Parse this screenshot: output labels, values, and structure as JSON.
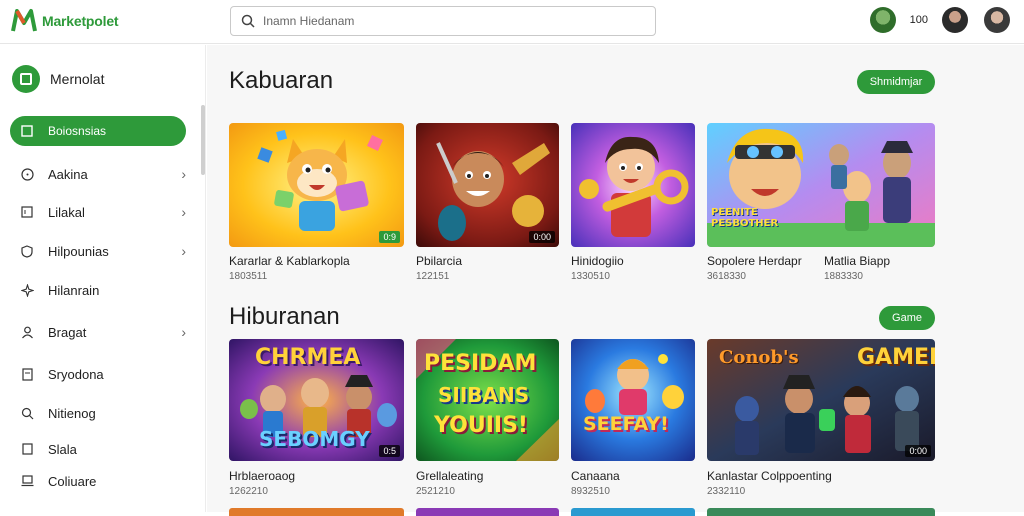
{
  "header": {
    "brand": "Marketpolet",
    "search_placeholder": "Inamn Hiedanam",
    "count": "100"
  },
  "sidebar": {
    "heading": "Mernolat",
    "items": [
      {
        "label": "Boiosnsias",
        "icon": "square-icon",
        "active": true
      },
      {
        "label": "Aakina",
        "icon": "circle-icon",
        "chevron": true
      },
      {
        "label": "Lilakal",
        "icon": "square-icon",
        "chevron": true
      },
      {
        "label": "Hilpounias",
        "icon": "shield-icon",
        "chevron": true
      },
      {
        "label": "Hilanrain",
        "icon": "sparkle-icon"
      },
      {
        "label": "Bragat",
        "icon": "person-icon",
        "chevron": true
      },
      {
        "label": "Sryodona",
        "icon": "document-icon"
      },
      {
        "label": "Nitienog",
        "icon": "search-icon"
      },
      {
        "label": "Slala",
        "icon": "square-icon"
      },
      {
        "label": "Coliuare",
        "icon": "laptop-icon"
      }
    ]
  },
  "sections": [
    {
      "title": "Kabuaran",
      "button": "Shmidmjar",
      "cards": [
        {
          "title": "Kararlar & Kablarkopla",
          "meta": "1803511",
          "badge": "0:9"
        },
        {
          "title": "Pbilarcia",
          "meta": "122151",
          "badge": "0:00"
        },
        {
          "title": "Hinidogiio",
          "meta": "1330510",
          "badge": ""
        },
        {
          "title": "Sopolere Herdapr",
          "meta": "3618330",
          "title2": "Matlia Biapp",
          "meta2": "1883330",
          "badge": "",
          "art_text": "PEENITE PESBOTHER"
        }
      ]
    },
    {
      "title": "Hiburanan",
      "button": "Game",
      "cards": [
        {
          "title": "Hrblaeroaog",
          "meta": "1262210",
          "badge": "0:5",
          "art_text_top": "CHRMEA",
          "art_text_bottom": "SEBOMGY"
        },
        {
          "title": "Grellaleating",
          "meta": "2521210",
          "badge": "",
          "art_text_top": "PESIDAM",
          "art_text_mid": "SIIBANS",
          "art_text_bottom": "YOUIIS!"
        },
        {
          "title": "Canaana",
          "meta": "8932510",
          "badge": "",
          "art_text_bottom": "SEEFAY!"
        },
        {
          "title": "Kanlastar Colppoenting",
          "meta": "2332110",
          "badge": "0:00",
          "art_text_left": "Conob's",
          "art_text_right": "GAMER"
        }
      ]
    }
  ]
}
